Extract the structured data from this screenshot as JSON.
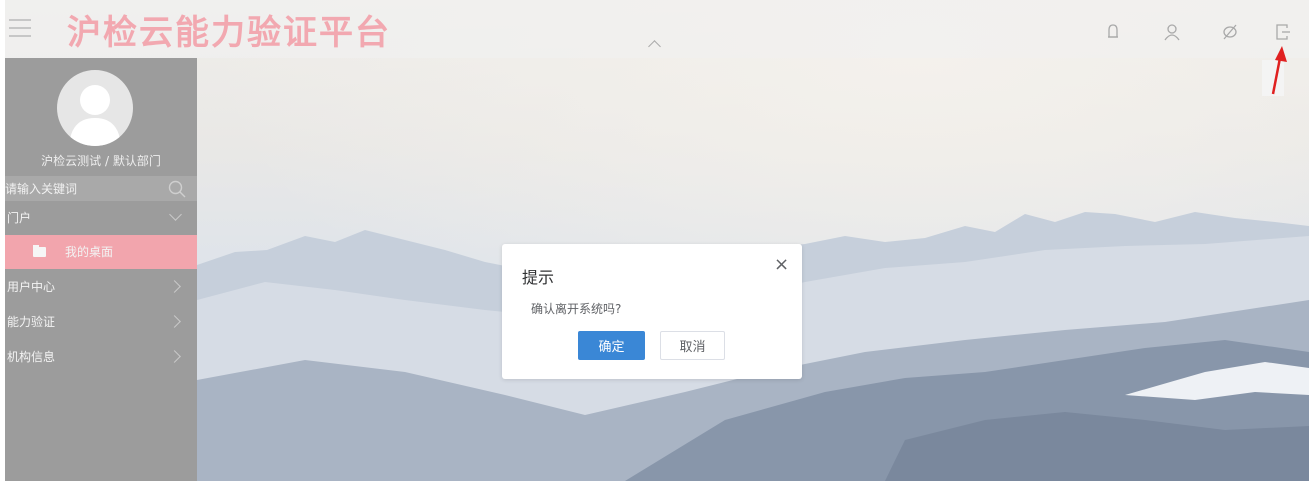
{
  "header": {
    "title": "沪检云能力验证平台",
    "icons": [
      "menu-icon",
      "bell-icon",
      "user-icon",
      "pen-slash-icon",
      "logout-icon"
    ]
  },
  "sidebar": {
    "user": "沪检云测试 / 默认部门",
    "search_placeholder": "请输入关键词",
    "items": [
      {
        "label": "门户"
      },
      {
        "label": "我的桌面"
      },
      {
        "label": "用户中心"
      },
      {
        "label": "能力验证"
      },
      {
        "label": "机构信息"
      }
    ]
  },
  "dialog": {
    "title": "提示",
    "close": "×",
    "message": "确认离开系统吗?",
    "confirm": "确定",
    "cancel": "取消"
  },
  "colors": {
    "accent": "#3a87d6",
    "title": "#f2a8b0",
    "active_nav": "#f2a5ad",
    "sidebar": "#9c9c9c",
    "annotation": "#e02020"
  }
}
